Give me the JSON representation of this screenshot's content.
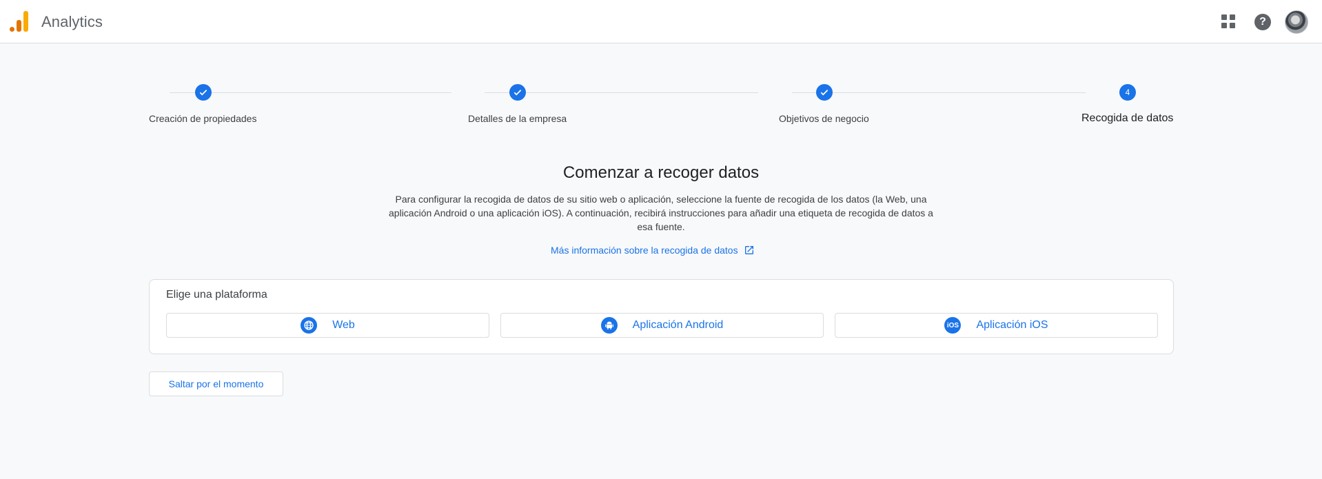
{
  "header": {
    "app_title": "Analytics",
    "icons": [
      "analytics-logo",
      "apps-grid-icon",
      "help-icon",
      "avatar"
    ]
  },
  "stepper": {
    "steps": [
      {
        "label": "Creación de propiedades",
        "state": "done"
      },
      {
        "label": "Detalles de la empresa",
        "state": "done"
      },
      {
        "label": "Objetivos de negocio",
        "state": "done"
      },
      {
        "label": "Recogida de datos",
        "state": "active",
        "number": "4"
      }
    ]
  },
  "main": {
    "heading": "Comenzar a recoger datos",
    "description": "Para configurar la recogida de datos de su sitio web o aplicación, seleccione la fuente de recogida de los datos (la Web, una aplicación Android o una aplicación iOS). A continuación, recibirá instrucciones para añadir una etiqueta de recogida de datos a esa fuente.",
    "learn_more": "Más información sobre la recogida de datos"
  },
  "platform": {
    "title": "Elige una plataforma",
    "options": [
      {
        "label": "Web",
        "icon": "globe-icon"
      },
      {
        "label": "Aplicación Android",
        "icon": "android-icon"
      },
      {
        "label": "Aplicación iOS",
        "icon": "ios-icon",
        "icon_text": "iOS"
      }
    ]
  },
  "skip_label": "Saltar por el momento",
  "colors": {
    "accent": "#1a73e8",
    "logo_dark": "#e37400",
    "logo_light": "#f9ab00",
    "border": "#dadce0"
  }
}
